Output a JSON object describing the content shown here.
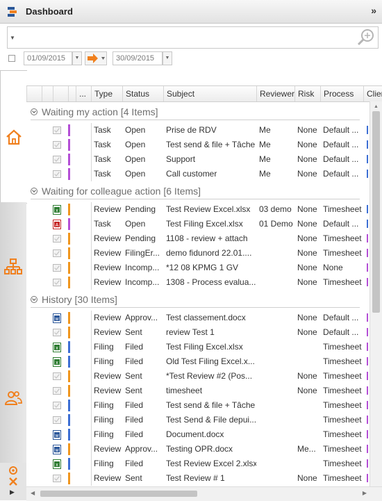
{
  "title": "Dashboard",
  "collapse_glyph": "»",
  "icons": {
    "logo": "app-logo-icon",
    "search": "magnifier-plus-icon",
    "home": "home-icon",
    "org": "org-chart-icon",
    "people": "people-icon"
  },
  "search": {
    "value": "",
    "placeholder": ""
  },
  "dates": {
    "from": "01/09/2015",
    "to": "30/09/2015"
  },
  "columns": [
    "...",
    "Type",
    "Status",
    "Subject",
    "Reviewer",
    "Risk",
    "Process",
    "Clien"
  ],
  "colors": {
    "accent": "#f0801e",
    "purple": "#b44fd6",
    "orange": "#f0961e",
    "blue": "#3d6fd4",
    "excel": "#2e7d32",
    "pdf": "#c62828",
    "word": "#2b579a"
  },
  "groups": [
    {
      "label": "Waiting my action",
      "count": "[4 Items]",
      "rows": [
        {
          "icon": "checkbox",
          "stripe": "purple",
          "type": "Task",
          "status": "Open",
          "subject": "Prise de RDV",
          "reviewer": "Me",
          "risk": "None",
          "process": "Default ..."
        },
        {
          "icon": "checkbox",
          "stripe": "purple",
          "type": "Task",
          "status": "Open",
          "subject": "Test send & file + Tâche",
          "reviewer": "Me",
          "risk": "None",
          "process": "Default ..."
        },
        {
          "icon": "checkbox",
          "stripe": "purple",
          "type": "Task",
          "status": "Open",
          "subject": "Support",
          "reviewer": "Me",
          "risk": "None",
          "process": "Default ..."
        },
        {
          "icon": "checkbox",
          "stripe": "purple",
          "type": "Task",
          "status": "Open",
          "subject": "Call customer",
          "reviewer": "Me",
          "risk": "None",
          "process": "Default ..."
        }
      ]
    },
    {
      "label": "Waiting for colleague action",
      "count": "[6 Items]",
      "rows": [
        {
          "icon": "excel",
          "stripe": "orange",
          "type": "Review",
          "status": "Pending",
          "subject": "Test Review Excel.xlsx",
          "reviewer": "03 demo",
          "risk": "None",
          "process": "Timesheet"
        },
        {
          "icon": "pdf",
          "stripe": "purple",
          "type": "Task",
          "status": "Open",
          "subject": "Test Filing Excel.xlsx",
          "reviewer": "01 Demo",
          "risk": "None",
          "process": "Default ..."
        },
        {
          "icon": "checkbox",
          "stripe": "orange",
          "type": "Review",
          "status": "Pending",
          "subject": "1108 - review + attach",
          "reviewer": "",
          "risk": "None",
          "process": "Timesheet"
        },
        {
          "icon": "checkbox",
          "stripe": "orange",
          "type": "Review",
          "status": "FilingEr...",
          "subject": "demo fidunord 22.01....",
          "reviewer": "",
          "risk": "None",
          "process": "Timesheet"
        },
        {
          "icon": "checkbox",
          "stripe": "orange",
          "type": "Review",
          "status": "Incomp...",
          "subject": "*12 08 KPMG 1 GV",
          "reviewer": "",
          "risk": "None",
          "process": "None"
        },
        {
          "icon": "checkbox",
          "stripe": "orange",
          "type": "Review",
          "status": "Incomp...",
          "subject": "1308 - Process evalua...",
          "reviewer": "",
          "risk": "None",
          "process": "Timesheet"
        }
      ]
    },
    {
      "label": "History",
      "count": "[30 Items]",
      "rows": [
        {
          "icon": "word",
          "stripe": "orange",
          "type": "Review",
          "status": "Approv...",
          "subject": "Test classement.docx",
          "reviewer": "",
          "risk": "None",
          "process": "Default ..."
        },
        {
          "icon": "checkbox",
          "stripe": "orange",
          "type": "Review",
          "status": "Sent",
          "subject": "review Test 1",
          "reviewer": "",
          "risk": "None",
          "process": "Default ..."
        },
        {
          "icon": "excel",
          "stripe": "blue",
          "type": "Filing",
          "status": "Filed",
          "subject": "Test Filing Excel.xlsx",
          "reviewer": "",
          "risk": "",
          "process": "Timesheet"
        },
        {
          "icon": "excel",
          "stripe": "blue",
          "type": "Filing",
          "status": "Filed",
          "subject": "Old Test Filing Excel.x...",
          "reviewer": "",
          "risk": "",
          "process": "Timesheet"
        },
        {
          "icon": "checkbox",
          "stripe": "orange",
          "type": "Review",
          "status": "Sent",
          "subject": "*Test Review #2 (Pos...",
          "reviewer": "",
          "risk": "None",
          "process": "Timesheet"
        },
        {
          "icon": "checkbox",
          "stripe": "orange",
          "type": "Review",
          "status": "Sent",
          "subject": "timesheet",
          "reviewer": "",
          "risk": "None",
          "process": "Timesheet"
        },
        {
          "icon": "checkbox",
          "stripe": "blue",
          "type": "Filing",
          "status": "Filed",
          "subject": "Test send & file + Tâche",
          "reviewer": "",
          "risk": "",
          "process": "Timesheet"
        },
        {
          "icon": "checkbox",
          "stripe": "blue",
          "type": "Filing",
          "status": "Filed",
          "subject": "Test Send & File depui...",
          "reviewer": "",
          "risk": "",
          "process": "Timesheet"
        },
        {
          "icon": "word",
          "stripe": "blue",
          "type": "Filing",
          "status": "Filed",
          "subject": "Document.docx",
          "reviewer": "",
          "risk": "",
          "process": "Timesheet"
        },
        {
          "icon": "word",
          "stripe": "orange",
          "type": "Review",
          "status": "Approv...",
          "subject": "Testing OPR.docx",
          "reviewer": "",
          "risk": "Me...",
          "process": "Timesheet"
        },
        {
          "icon": "excel",
          "stripe": "blue",
          "type": "Filing",
          "status": "Filed",
          "subject": "Test Review Excel 2.xlsx",
          "reviewer": "",
          "risk": "",
          "process": "Timesheet"
        },
        {
          "icon": "checkbox",
          "stripe": "orange",
          "type": "Review",
          "status": "Sent",
          "subject": "Test Review # 1",
          "reviewer": "",
          "risk": "None",
          "process": "Timesheet"
        }
      ]
    }
  ]
}
